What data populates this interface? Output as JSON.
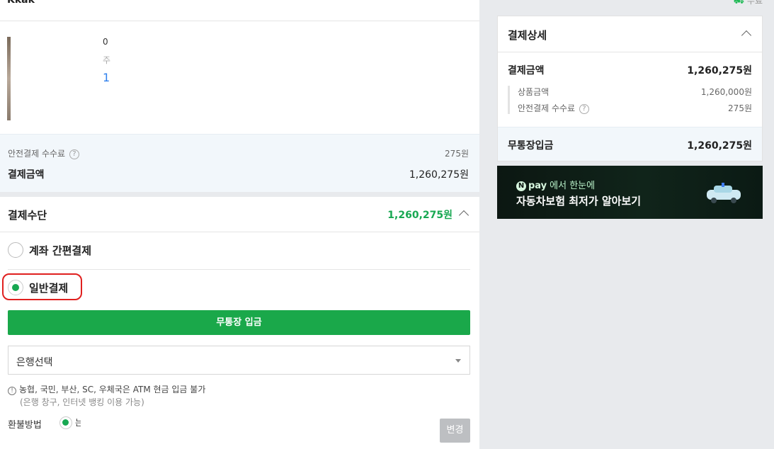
{
  "header": {
    "seller": "Kkak",
    "link": "무료"
  },
  "product": {
    "line1": "0",
    "unit": "주",
    "qty": "1"
  },
  "fee_box": {
    "fee_label": "안전결제 수수료",
    "fee_value": "275원",
    "pay_label": "결제금액",
    "pay_value": "1,260,275원"
  },
  "payment_method": {
    "title": "결제수단",
    "amount": "1,260,275원",
    "options": [
      {
        "label": "계좌 간편결제",
        "selected": false
      },
      {
        "label": "일반결제",
        "selected": true
      }
    ],
    "transfer_button": "무통장 입금",
    "bank_select_value": "은행선택",
    "notice_line1": "농협, 국민, 부산, SC, 우체국은 ATM 현금 입금 불가",
    "notice_line2": "(은행 창구, 인터넷 뱅킹 이용 가능)",
    "refund_label": "환불방법",
    "refund_text": "는 N",
    "change_button": "변경"
  },
  "detail": {
    "title": "결제상세",
    "total_label": "결제금액",
    "total_value": "1,260,275원",
    "product_label": "상품금액",
    "product_value": "1,260,000원",
    "fee_label": "안전결제 수수료",
    "fee_value": "275원",
    "bank_label": "무통장입금",
    "bank_value": "1,260,275원"
  },
  "banner": {
    "brand": "N",
    "pay": "pay",
    "tagline": "에서 한눈에",
    "title": "자동차보험 최저가 알아보기"
  },
  "colors": {
    "accent_green": "#1aa84a",
    "amount_green": "#18a852",
    "highlight_red": "#e0201f"
  }
}
